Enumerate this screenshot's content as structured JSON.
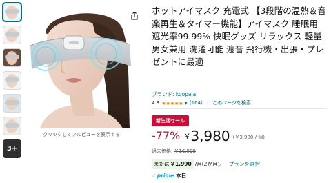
{
  "thumbnails": {
    "more_label": "3+"
  },
  "main_image": {
    "caption": "クリックしてフルビューを表示する"
  },
  "product": {
    "title": "ホットアイマスク 充電式 【3段階の温熱＆音楽再生＆タイマー機能】アイマスク 睡眠用 遮光率99.99% 快眠グッズ リラックス 軽量 男女兼用 洗濯可能 遮音 飛行機・出張・プレゼントに最適",
    "brand_link": "ブランド: koopala"
  },
  "rating": {
    "value": "4.8",
    "stars": "★★★★★",
    "review_count": "(164)",
    "search_link": "このページを検索"
  },
  "deal": {
    "badge": "新生活セール",
    "badge_color": "#cc0c39"
  },
  "price": {
    "discount": "-77%",
    "currency": "￥",
    "amount": "3,980",
    "unit_price": "(￥3,980 / 個)",
    "list_price_label": "過去価格:",
    "list_price": "￥16,999"
  },
  "installment": {
    "prefix": "または",
    "amount": "￥1,990",
    "suffix": "/月(2か月)。",
    "plan_link": "プランを選択"
  },
  "prime": {
    "logo_text": "prime",
    "delivery": "本日"
  },
  "colors": {
    "link": "#007185",
    "deal_red": "#cc0c39",
    "star": "#f08804",
    "prime_blue": "#00a8e1"
  }
}
